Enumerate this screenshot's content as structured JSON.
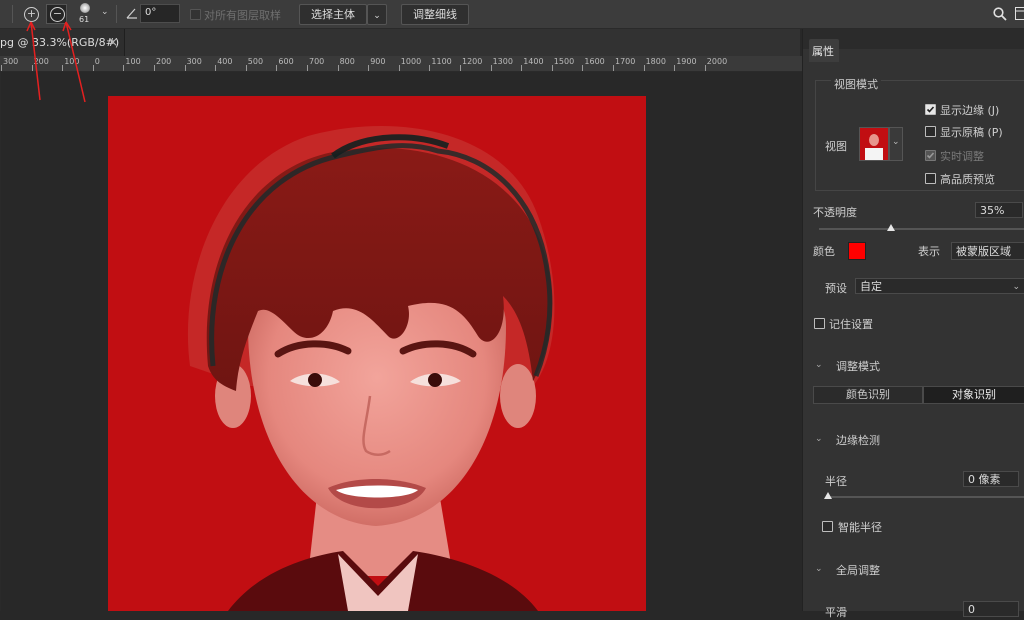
{
  "toolbar": {
    "brush_size": "61",
    "angle_value": "0°",
    "sample_all_layers_label": "对所有图层取样",
    "select_subject_label": "选择主体",
    "refine_edge_label": "调整细线"
  },
  "document_tab": {
    "title": "pg @ 33.3%(RGB/8#)",
    "close": "×"
  },
  "ruler": {
    "labels": [
      "300",
      "200",
      "100",
      "0",
      "100",
      "200",
      "300",
      "400",
      "500",
      "600",
      "700",
      "800",
      "900",
      "1000",
      "1100",
      "1200",
      "1300",
      "1400",
      "1500",
      "1600",
      "1700",
      "1800",
      "1900",
      "2000"
    ]
  },
  "panel": {
    "tab_label": "属性",
    "view_mode": {
      "section_label": "视图模式",
      "view_label": "视图",
      "show_edge_label": "显示边缘 (J)",
      "show_original_label": "显示原稿 (P)",
      "realtime_label": "实时调整",
      "hq_preview_label": "高品质预览"
    },
    "opacity_label": "不透明度",
    "opacity_value": "35%",
    "opacity_fraction": 0.35,
    "color_label": "颜色",
    "overlay_color": "#ff0000",
    "display_label": "表示",
    "display_value": "被蒙版区域",
    "preset_label": "预设",
    "preset_value": "自定",
    "remember_label": "记住设置",
    "adjust_mode": {
      "section_label": "调整模式",
      "color_recog_label": "颜色识别",
      "object_recog_label": "对象识别"
    },
    "edge_detect": {
      "section_label": "边缘检测",
      "radius_label": "半径",
      "radius_value": "0 像素",
      "smart_radius_label": "智能半径"
    },
    "global_adjust": {
      "section_label": "全局调整",
      "smooth_label": "平滑",
      "smooth_value": "0"
    }
  }
}
